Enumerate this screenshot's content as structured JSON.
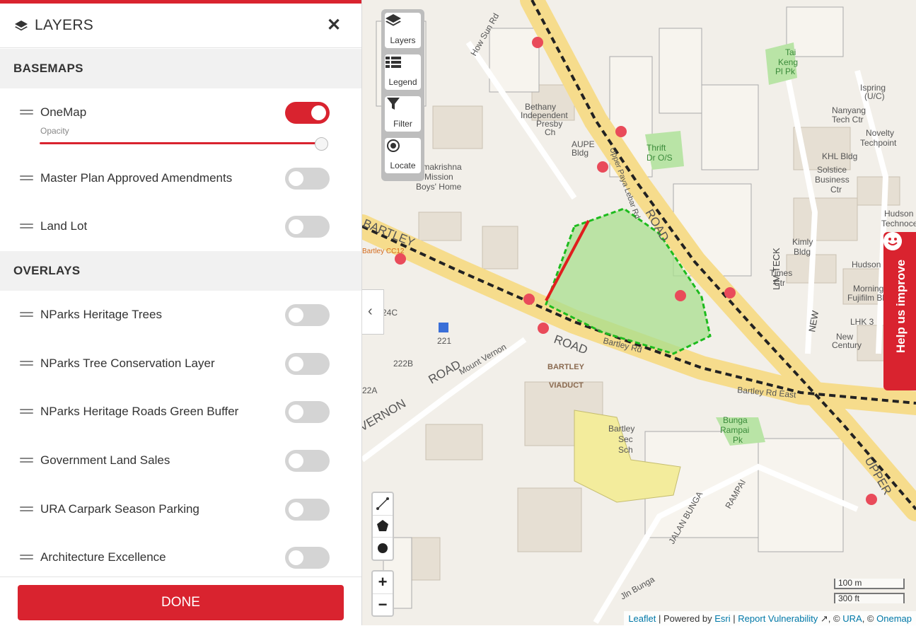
{
  "panel": {
    "title": "LAYERS",
    "close_label": "✕",
    "basemaps_heading": "BASEMAPS",
    "overlays_heading": "OVERLAYS",
    "basemaps": [
      {
        "label": "OneMap",
        "enabled": true
      },
      {
        "label": "Master Plan Approved Amendments",
        "enabled": false
      },
      {
        "label": "Land Lot",
        "enabled": false
      }
    ],
    "opacity_label": "Opacity",
    "opacity_value": 0.97,
    "overlays": [
      {
        "label": "NParks Heritage Trees",
        "enabled": false
      },
      {
        "label": "NParks Tree Conservation Layer",
        "enabled": false
      },
      {
        "label": "NParks Heritage Roads Green Buffer",
        "enabled": false
      },
      {
        "label": "Government Land Sales",
        "enabled": false
      },
      {
        "label": "URA Carpark Season Parking",
        "enabled": false
      },
      {
        "label": "Architecture Excellence",
        "enabled": false
      }
    ],
    "done_label": "DONE"
  },
  "map_controls": {
    "layers": "Layers",
    "legend": "Legend",
    "filter": "Filter",
    "locate": "Locate",
    "collapse": "‹",
    "zoom_in": "+",
    "zoom_out": "−"
  },
  "scale": {
    "metric": "100 m",
    "imperial": "300 ft"
  },
  "attribution": {
    "leaflet": "Leaflet",
    "powered_by": "| Powered by",
    "esri": "Esri",
    "sep": "|",
    "report": "Report Vulnerability",
    "copy1": ", ©",
    "ura": "URA",
    "copy2": ", ©",
    "onemap": "Onemap"
  },
  "help_tab": "Help us improve",
  "map_labels": {
    "bartley_road": "ROAD",
    "upper_road": "ROAD",
    "bartley_viaduct_1": "BARTLEY",
    "bartley_viaduct_2": "VIADUCT",
    "bartley_sec_1": "Bartley",
    "bartley_sec_2": "Sec",
    "bartley_sec_3": "Sch",
    "bartley_rd": "Bartley Rd",
    "bartley_rd_east": "Bartley Rd East",
    "mount_vernon": "Mount Vernon",
    "vernon_road": "ROAD",
    "vernon": "VERNON",
    "aupe_1": "AUPE",
    "aupe_2": "Bldg",
    "thrift_1": "Thrift",
    "thrift_2": "Dr O/S",
    "bethany_1": "Bethany",
    "bethany_2": "Independent",
    "bethany_3": "Presby",
    "bethany_4": "Ch",
    "bunga_1": "Bunga",
    "bunga_2": "Rampai",
    "bunga_3": "Pk",
    "nanyang_1": "Nanyang",
    "nanyang_2": "Tech Ctr",
    "novelty_1": "Novelty",
    "novelty_2": "Techpoint",
    "khl": "KHL Bldg",
    "solstice_1": "Solstice",
    "solstice_2": "Business",
    "solstice_3": "Ctr",
    "hudson_1": "Hudson",
    "hudson_2": "Technocent",
    "hudson_3": "Hudson",
    "kimly_1": "Kimly",
    "kimly_2": "Bldg",
    "times_1": "Times",
    "times_2": "Ctr",
    "morningstar_1": "Morningst",
    "morningstar_2": "Fujifilm Bld",
    "lhk": "LHK 3",
    "newcentury_1": "New",
    "newcentury_2": "Century",
    "ispring_1": "Ispring",
    "ispring_2": "(U/C)",
    "tai_keng_1": "Tai",
    "tai_keng_2": "Keng",
    "tai_keng_3": "Pl Pk",
    "upper_lower": "UPPER",
    "mission_1": "Ramakrishna",
    "mission_2": "Mission",
    "mission_3": "Boys' Home",
    "block_221": "221",
    "block_222b": "222B",
    "block_222a": "22A",
    "block_224c": "24C",
    "lim_teck": "LIM TECK",
    "new_ind": "NEW",
    "jin_bunga": "Jln Bunga",
    "how_sun": "How Sun Rd",
    "jalan_bunga": "JALAN BUNGA",
    "rampai": "RAMPAI",
    "upper_paya": "Upper Paya Lebar Rd",
    "bartley_partial": "BARTLEY",
    "bartley_cc": "Bartley CC12"
  }
}
